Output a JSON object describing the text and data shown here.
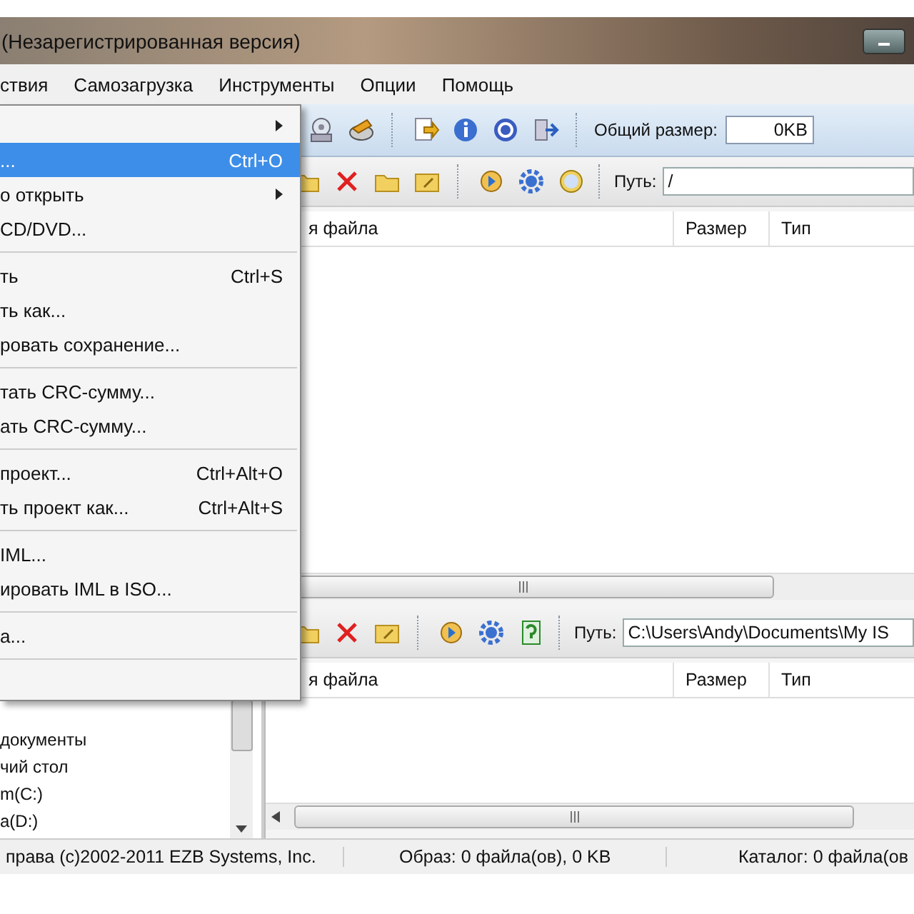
{
  "window": {
    "title": "(Незарегистрированная версия)"
  },
  "menu_bar": [
    "ствия",
    "Самозагрузка",
    "Инструменты",
    "Опции",
    "Помощь"
  ],
  "open_menu": {
    "items": [
      {
        "kind": "item",
        "submenu": true,
        "selected": false
      },
      {
        "kind": "item",
        "label": "...",
        "shortcut": "Ctrl+O",
        "selected": true
      },
      {
        "kind": "item",
        "label": "о открыть",
        "submenu": true,
        "selected": false
      },
      {
        "kind": "item",
        "label": "CD/DVD...",
        "selected": false
      },
      {
        "kind": "separator"
      },
      {
        "kind": "item",
        "label": "ть",
        "shortcut": "Ctrl+S",
        "selected": false
      },
      {
        "kind": "item",
        "label": "ть как...",
        "selected": false
      },
      {
        "kind": "item",
        "label": "ровать сохранение...",
        "selected": false
      },
      {
        "kind": "separator"
      },
      {
        "kind": "item",
        "label": "тать CRC-сумму...",
        "selected": false
      },
      {
        "kind": "item",
        "label": "ать CRC-сумму...",
        "selected": false
      },
      {
        "kind": "separator"
      },
      {
        "kind": "item",
        "label": "проект...",
        "shortcut": "Ctrl+Alt+O",
        "selected": false
      },
      {
        "kind": "item",
        "label": "ть проект как...",
        "shortcut": "Ctrl+Alt+S",
        "selected": false
      },
      {
        "kind": "separator"
      },
      {
        "kind": "item",
        "label": "IML...",
        "selected": false
      },
      {
        "kind": "item",
        "label": "ировать IML в ISO...",
        "selected": false
      },
      {
        "kind": "separator"
      },
      {
        "kind": "item",
        "label": "а...",
        "selected": false
      },
      {
        "kind": "separator"
      }
    ]
  },
  "toolbar": {
    "total_size_label": "Общий размер:",
    "total_size_value": "0KB"
  },
  "image_pane": {
    "path_label": "Путь:",
    "path": "/",
    "columns": [
      "я файла",
      "Размер",
      "Тип"
    ]
  },
  "local_pane": {
    "path_label": "Путь:",
    "path": "C:\\Users\\Andy\\Documents\\My IS",
    "columns": [
      "я файла",
      "Размер",
      "Тип"
    ]
  },
  "folder_tree": {
    "items": [
      "документы",
      "чий стол",
      "m(C:)",
      "a(D:)"
    ]
  },
  "status_bar": [
    "права (c)2002-2011 EZB Systems, Inc.",
    "Образ: 0 файла(ов), 0 KB",
    "Каталог: 0 файла(ов"
  ]
}
